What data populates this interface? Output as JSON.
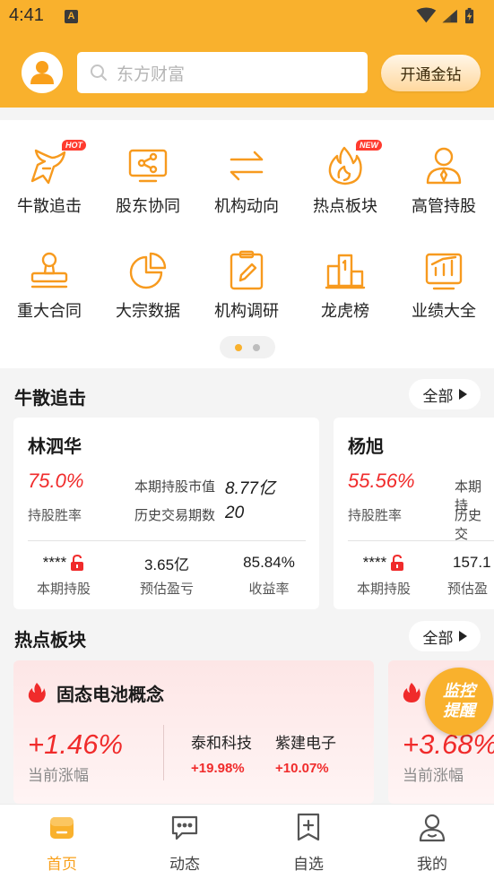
{
  "status_bar": {
    "time": "4:41",
    "notification": "A"
  },
  "header": {
    "search_placeholder": "东方财富",
    "vip_button": "开通金钻"
  },
  "menu": {
    "items": [
      {
        "label": "牛散追击",
        "icon": "bull-head-icon",
        "tag": "HOT"
      },
      {
        "label": "股东协同",
        "icon": "shareholder-network-icon",
        "tag": ""
      },
      {
        "label": "机构动向",
        "icon": "swap-arrows-icon",
        "tag": ""
      },
      {
        "label": "热点板块",
        "icon": "flame-icon",
        "tag": "NEW"
      },
      {
        "label": "高管持股",
        "icon": "executive-icon",
        "tag": ""
      },
      {
        "label": "重大合同",
        "icon": "stamp-icon",
        "tag": ""
      },
      {
        "label": "大宗数据",
        "icon": "pie-chart-icon",
        "tag": ""
      },
      {
        "label": "机构调研",
        "icon": "clipboard-edit-icon",
        "tag": ""
      },
      {
        "label": "龙虎榜",
        "icon": "podium-icon",
        "tag": ""
      },
      {
        "label": "业绩大全",
        "icon": "bar-chart-board-icon",
        "tag": ""
      }
    ],
    "page_count": 2,
    "active_page": 1
  },
  "investor_section": {
    "title": "牛散追击",
    "all_label": "全部",
    "cards": [
      {
        "name": "林泗华",
        "win_rate": "75.0%",
        "win_rate_label": "持股胜率",
        "market_value_label": "本期持股市值",
        "market_value": "8.77亿",
        "history_label": "历史交易期数",
        "history_value": "20",
        "holding_value": "****",
        "holding_label": "本期持股",
        "profit_value": "3.65亿",
        "profit_label": "预估盈亏",
        "return_value": "85.84%",
        "return_label": "收益率"
      },
      {
        "name": "杨旭",
        "win_rate": "55.56%",
        "win_rate_label": "持股胜率",
        "market_value_label": "本期持",
        "history_label": "历史交",
        "holding_value": "****",
        "holding_label": "本期持股",
        "profit_value": "157.1",
        "profit_label": "预估盈"
      }
    ]
  },
  "sector_section": {
    "title": "热点板块",
    "all_label": "全部",
    "cards": [
      {
        "name": "固态电池概念",
        "change": "+1.46%",
        "change_label": "当前涨幅",
        "stocks": [
          {
            "name": "泰和科技",
            "change": "+19.98%"
          },
          {
            "name": "紫建电子",
            "change": "+10.07%"
          }
        ]
      },
      {
        "name": "",
        "change": "+3.68%",
        "change_label": "当前涨幅"
      }
    ]
  },
  "floating_button": {
    "line1": "监控",
    "line2": "提醒"
  },
  "bottom_nav": {
    "items": [
      {
        "label": "首页",
        "icon": "home-icon",
        "active": true
      },
      {
        "label": "动态",
        "icon": "chat-bubble-icon",
        "active": false
      },
      {
        "label": "自选",
        "icon": "bookmark-add-icon",
        "active": false
      },
      {
        "label": "我的",
        "icon": "user-icon",
        "active": false
      }
    ]
  },
  "colors": {
    "brand": "#f9b12d",
    "up": "#f02b2b",
    "icon_orange": "#f79a1e"
  }
}
